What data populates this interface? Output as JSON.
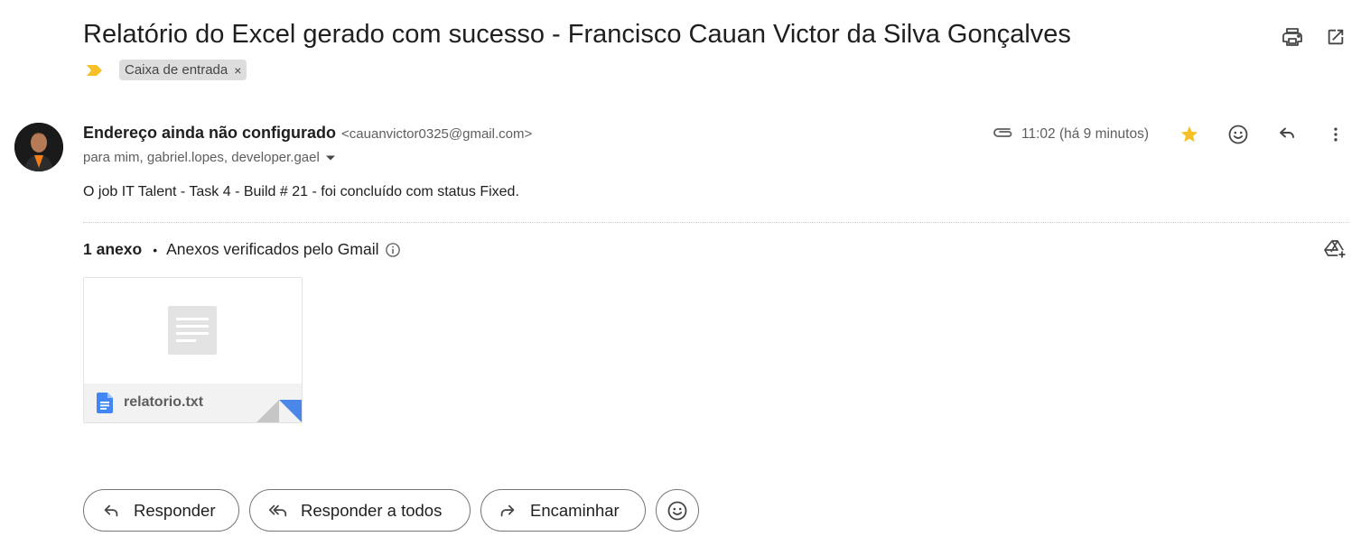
{
  "subject": "Relatório do Excel gerado com sucesso - Francisco Cauan Victor da Silva Gonçalves",
  "header_icons": {
    "print": "printer-icon",
    "open_new_window": "open-in-new-icon"
  },
  "label": {
    "name": "Caixa de entrada",
    "remove": "×",
    "importance_color": "#f6c026"
  },
  "sender": {
    "name": "Endereço ainda não configurado",
    "email": "<cauanvictor0325@gmail.com>",
    "recipients": "para mim, gabriel.lopes, developer.gael"
  },
  "meta": {
    "time": "11:02 (há 9 minutos)",
    "star_color": "#f6c026"
  },
  "body": "O job IT Talent - Task 4 - Build # 21 - foi concluído com status Fixed.",
  "attachments": {
    "count_label": "1 anexo",
    "separator": "•",
    "verified_label": "Anexos verificados pelo Gmail",
    "files": [
      {
        "name": "relatorio.txt"
      }
    ]
  },
  "actions": {
    "reply": "Responder",
    "reply_all": "Responder a todos",
    "forward": "Encaminhar"
  }
}
